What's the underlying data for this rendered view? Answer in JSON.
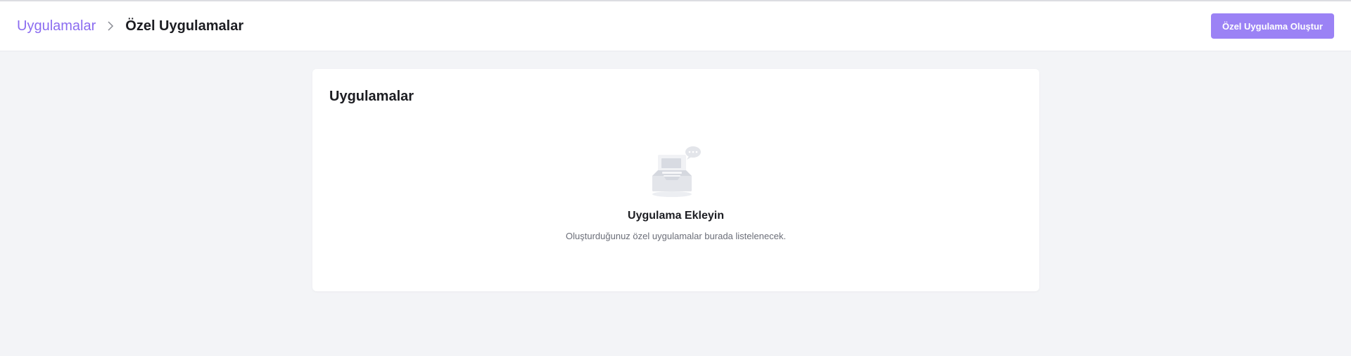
{
  "breadcrumb": {
    "parent": "Uygulamalar",
    "current": "Özel Uygulamalar",
    "separator_icon": "chevron-right-icon"
  },
  "header": {
    "create_button_label": "Özel Uygulama Oluştur"
  },
  "card": {
    "title": "Uygulamalar",
    "empty_state": {
      "icon": "empty-inbox-icon",
      "title": "Uygulama Ekleyin",
      "description": "Oluşturduğunuz özel uygulamalar burada listelenecek."
    }
  },
  "colors": {
    "accent": "#9b82f5",
    "link": "#8b6cf0",
    "background": "#f3f4f7"
  }
}
